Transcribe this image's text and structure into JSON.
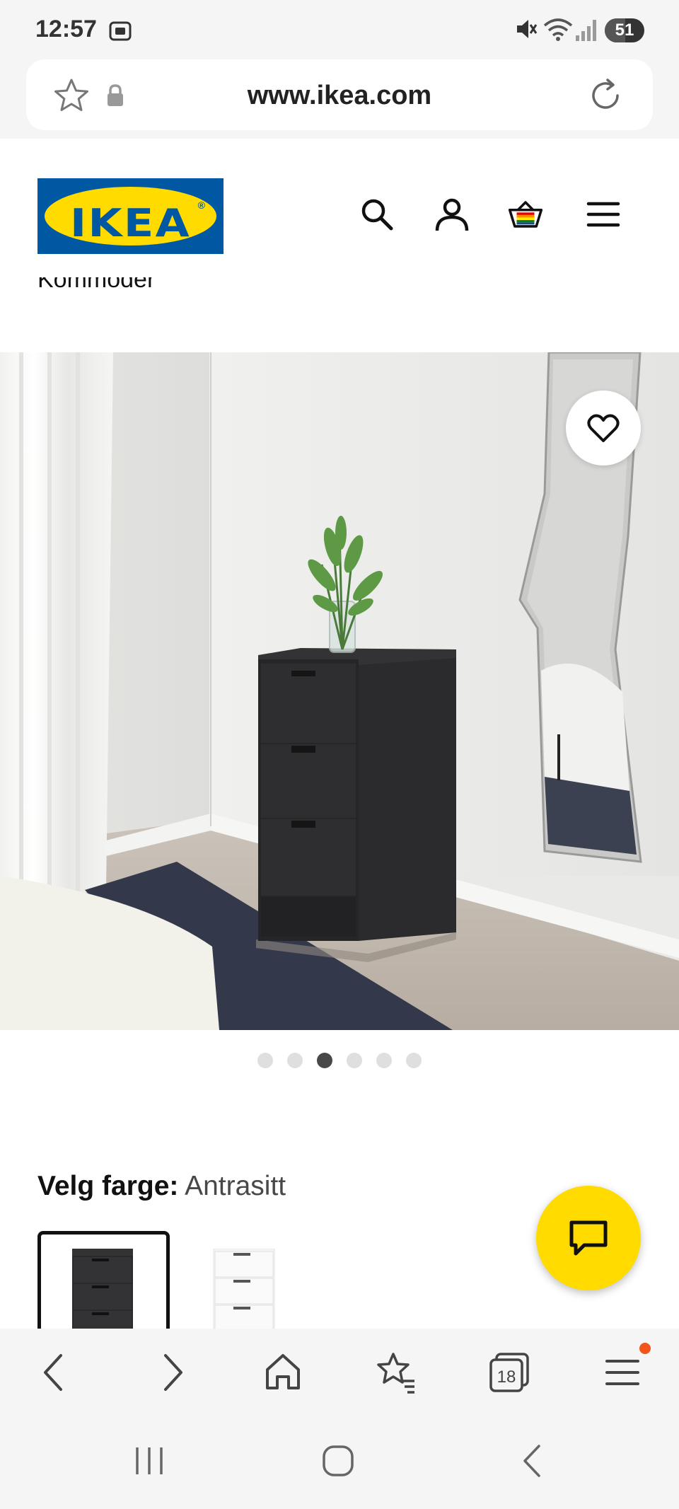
{
  "status_bar": {
    "time": "12:57",
    "battery_level": "51",
    "icons": [
      "screenshot-icon",
      "mute-icon",
      "wifi-icon",
      "signal-icon",
      "battery-icon"
    ]
  },
  "browser": {
    "url": "www.ikea.com",
    "icons": [
      "star-icon",
      "lock-icon",
      "reload-icon"
    ],
    "bottom_nav": [
      "back-icon",
      "forward-icon",
      "home-icon",
      "bookmarks-icon",
      "tabs-icon",
      "menu-icon"
    ],
    "tab_count": "18"
  },
  "header": {
    "logo_text": "IKEA",
    "icons": [
      "search-icon",
      "account-icon",
      "cart-icon",
      "menu-icon"
    ]
  },
  "breadcrumb": "Kommoder",
  "product": {
    "image_count": 6,
    "active_image_index": 2
  },
  "color_selection": {
    "label": "Velg farge:",
    "selected_value": "Antrasitt",
    "swatches": [
      "anthracite",
      "white"
    ]
  },
  "colors": {
    "ikea_blue": "#0058a3",
    "ikea_yellow": "#ffdb00",
    "notification_dot": "#f2541b"
  }
}
